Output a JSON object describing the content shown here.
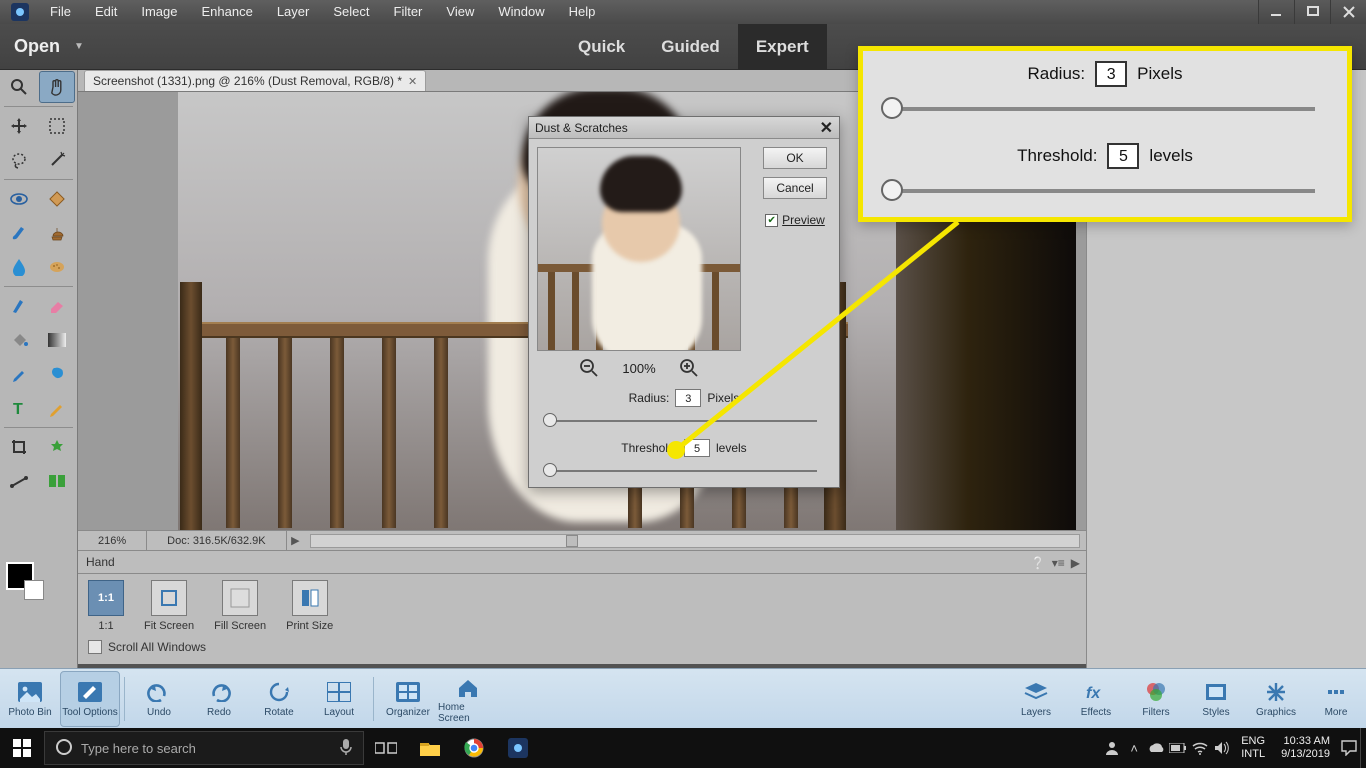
{
  "menu": {
    "items": [
      "File",
      "Edit",
      "Image",
      "Enhance",
      "Layer",
      "Select",
      "Filter",
      "View",
      "Window",
      "Help"
    ]
  },
  "toolbar": {
    "open": "Open",
    "modes": [
      "Quick",
      "Guided",
      "Expert"
    ],
    "active_mode": 2
  },
  "doc_tab": {
    "title": "Screenshot (1331).png @ 216% (Dust Removal, RGB/8) *"
  },
  "status": {
    "zoom": "216%",
    "doc": "Doc: 316.5K/632.9K"
  },
  "tool_options": {
    "title": "Hand",
    "buttons": [
      {
        "label": "1:1",
        "text": "1:1",
        "selected": true
      },
      {
        "label": "Fit Screen"
      },
      {
        "label": "Fill Screen"
      },
      {
        "label": "Print Size"
      }
    ],
    "scroll_all": "Scroll All Windows"
  },
  "panels_left": [
    {
      "label": "Photo Bin"
    },
    {
      "label": "Tool Options",
      "selected": true
    },
    {
      "label": "Undo"
    },
    {
      "label": "Redo"
    },
    {
      "label": "Rotate"
    },
    {
      "label": "Layout"
    },
    {
      "label": "Organizer"
    },
    {
      "label": "Home Screen"
    }
  ],
  "panels_right": [
    {
      "label": "Layers"
    },
    {
      "label": "Effects"
    },
    {
      "label": "Filters"
    },
    {
      "label": "Styles"
    },
    {
      "label": "Graphics"
    },
    {
      "label": "More"
    }
  ],
  "dialog": {
    "title": "Dust & Scratches",
    "ok": "OK",
    "cancel": "Cancel",
    "preview": "Preview",
    "preview_checked": true,
    "zoom": "100%",
    "radius_label": "Radius:",
    "radius_value": "3",
    "radius_unit": "Pixels",
    "threshold_label": "Threshold:",
    "threshold_value": "5",
    "threshold_unit": "levels"
  },
  "callout": {
    "radius_label": "Radius:",
    "radius_value": "3",
    "radius_unit": "Pixels",
    "threshold_label": "Threshold:",
    "threshold_value": "5",
    "threshold_unit": "levels"
  },
  "taskbar": {
    "search_placeholder": "Type here to search",
    "lang1": "ENG",
    "lang2": "INTL",
    "time": "10:33 AM",
    "date": "9/13/2019"
  }
}
